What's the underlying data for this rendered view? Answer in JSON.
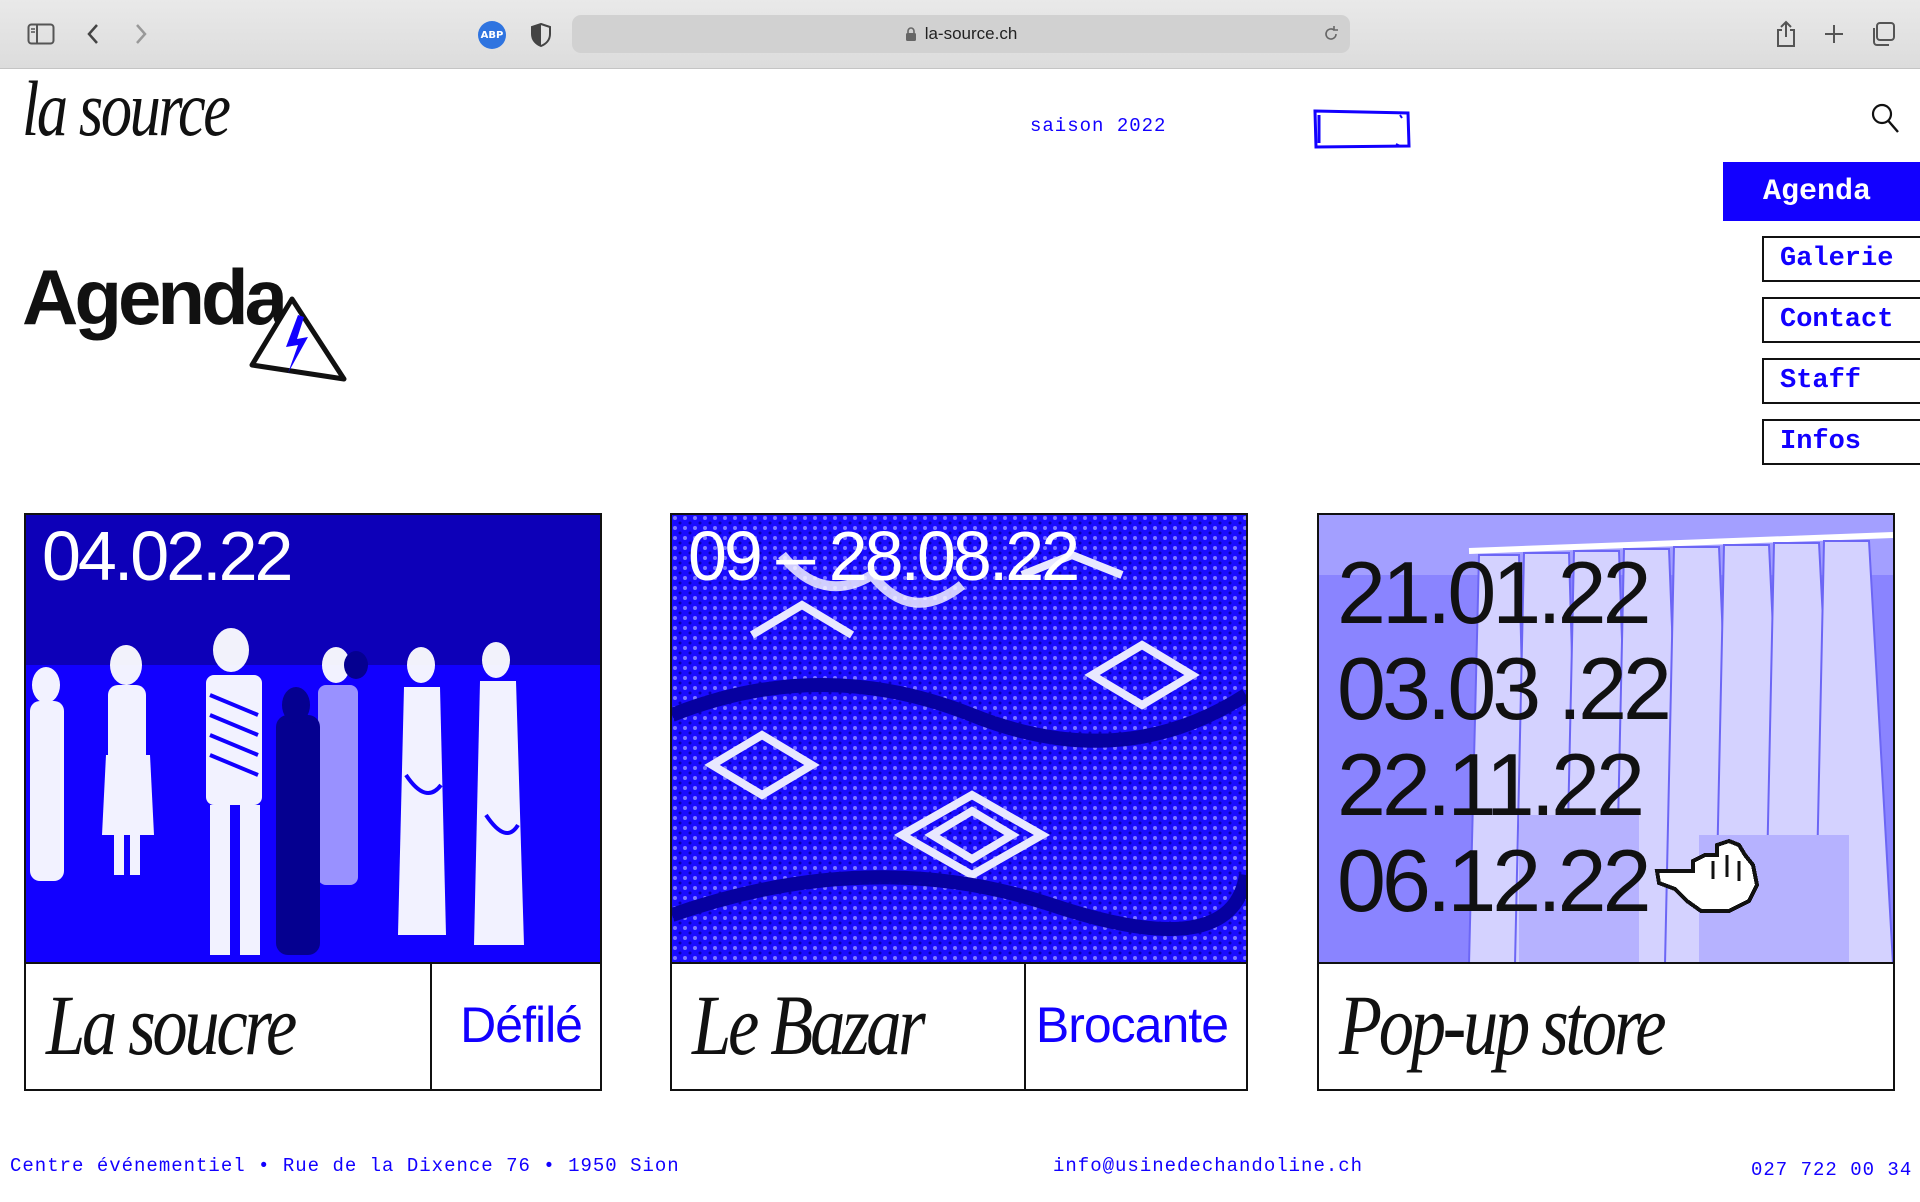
{
  "browser": {
    "url": "la-source.ch",
    "adblock_label": "ABP"
  },
  "site": {
    "logo": "la source",
    "season": "saison 2022",
    "accent_color": "#1200ff"
  },
  "nav": {
    "active": "Agenda",
    "items": [
      "Galerie",
      "Contact",
      "Staff",
      "Infos"
    ]
  },
  "page": {
    "title": "Agenda"
  },
  "cards": [
    {
      "date": "04.02.22",
      "title": "La soucre",
      "tag": "Défilé"
    },
    {
      "date": "09 – 28.08.22",
      "title": "Le Bazar",
      "tag": "Brocante"
    },
    {
      "dates": [
        "21.01.22",
        "03.03 .22",
        "22.11.22",
        "06.12.22"
      ],
      "title": "Pop-up store"
    }
  ],
  "footer": {
    "address": "Centre événementiel • Rue de la Dixence 76 • 1950 Sion",
    "email": "info@usinedechandoline.ch",
    "phone": "027 722 00 34"
  }
}
